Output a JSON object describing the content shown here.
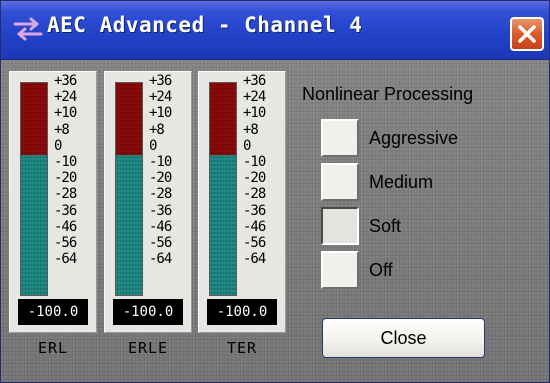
{
  "window": {
    "title": "AEC Advanced - Channel 4",
    "title_icon": "swap-arrows-icon",
    "close_icon": "close-icon"
  },
  "meters": [
    {
      "label": "ERL",
      "readout": "-100.0",
      "level_fraction": 0.66
    },
    {
      "label": "ERLE",
      "readout": "-100.0",
      "level_fraction": 0.66
    },
    {
      "label": "TER",
      "readout": "-100.0",
      "level_fraction": 0.66
    }
  ],
  "meter_scale": [
    "+36",
    "+24",
    "+10",
    "+8",
    "0",
    "-10",
    "-20",
    "-28",
    "-36",
    "-46",
    "-56",
    "-64"
  ],
  "nonlinear": {
    "title": "Nonlinear Processing",
    "options": [
      {
        "label": "Aggressive",
        "selected": false
      },
      {
        "label": "Medium",
        "selected": false
      },
      {
        "label": "Soft",
        "selected": true
      },
      {
        "label": "Off",
        "selected": false
      }
    ]
  },
  "buttons": {
    "close_label": "Close"
  },
  "colors": {
    "title_bar": "#2343c8",
    "meter_red": "#8b0b0b",
    "meter_teal": "#1f8a84",
    "close_x": "#d85a2c",
    "background": "#7b7b7b"
  }
}
